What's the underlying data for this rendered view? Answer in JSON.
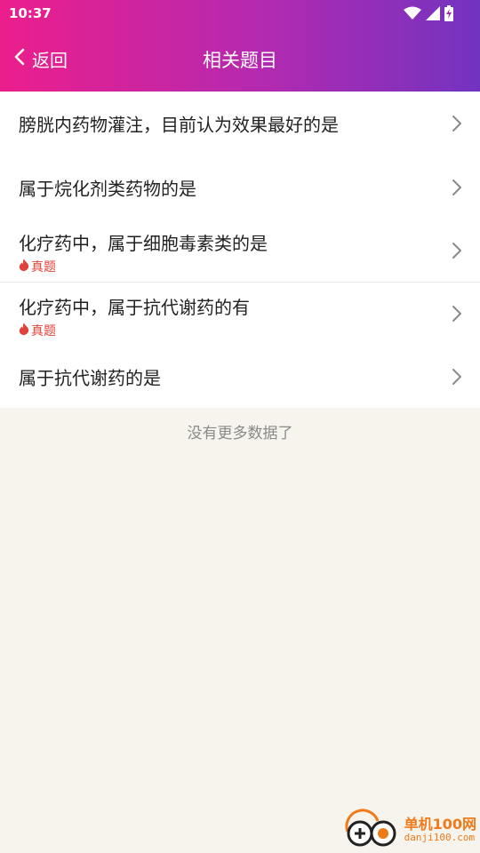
{
  "status_bar": {
    "time": "10:37",
    "icons": [
      "wifi-icon",
      "signal-icon",
      "battery-charging-icon"
    ]
  },
  "nav": {
    "back_label": "返回",
    "title": "相关题目"
  },
  "questions": [
    {
      "text": "膀胱内药物灌注，目前认为效果最好的是",
      "tag": ""
    },
    {
      "text": "属于烷化剂类药物的是",
      "tag": ""
    },
    {
      "text": "化疗药中，属于细胞毒素类的是",
      "tag": "真题"
    },
    {
      "text": "化疗药中，属于抗代谢药的有",
      "tag": "真题"
    },
    {
      "text": "属于抗代谢药的是",
      "tag": ""
    }
  ],
  "footer": {
    "no_more_text": "没有更多数据了"
  },
  "watermark": {
    "title": "单机100网",
    "subtitle": "danji100.com"
  },
  "colors": {
    "header_gradient_start": "#ec1e8c",
    "header_gradient_end": "#7233c0",
    "tag_color": "#e0433a",
    "page_background": "#f7f4ee"
  }
}
